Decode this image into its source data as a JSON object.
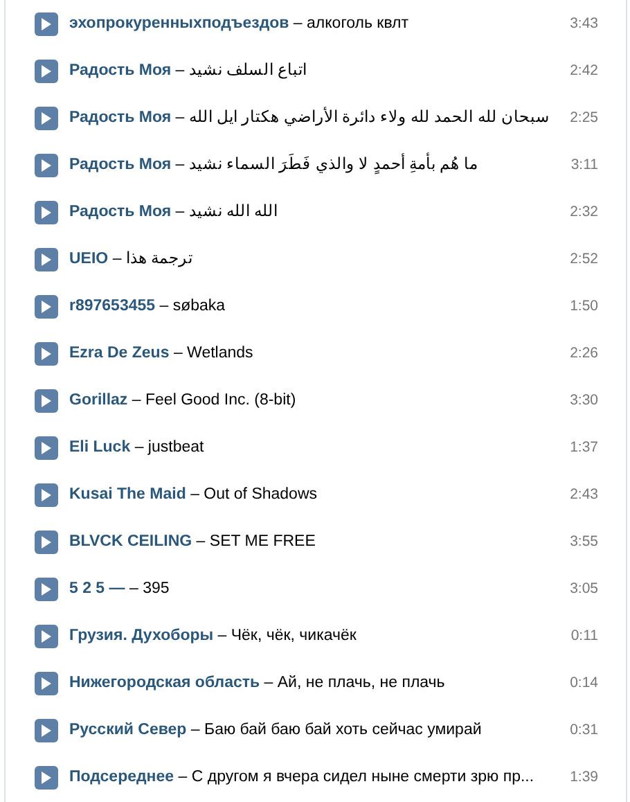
{
  "separator": "–",
  "tracks": [
    {
      "artist": "эхопрокуренныхподъездов",
      "title": "алкоголь квлт",
      "duration": "3:43"
    },
    {
      "artist": "Радость Моя",
      "title": "اتباع السلف نشيد",
      "duration": "2:42"
    },
    {
      "artist": "Радость Моя",
      "title": "سبحان لله الحمد لله ولاء دائرة الأراضي هكتار ايل الله",
      "duration": "2:25"
    },
    {
      "artist": "Радость Моя",
      "title": "ما هُم بأمةِ أحمدٍ لا والذي فَطَرَ السماء نشيد",
      "duration": "3:11"
    },
    {
      "artist": "Радость Моя",
      "title": "الله الله نشيد",
      "duration": "2:32"
    },
    {
      "artist": "UEIO",
      "title": "ترجمة هذا",
      "duration": "2:52"
    },
    {
      "artist": "r897653455",
      "title": "søbaka",
      "duration": "1:50"
    },
    {
      "artist": "Ezra De Zeus",
      "title": "Wetlands",
      "duration": "2:26"
    },
    {
      "artist": "Gorillaz",
      "title": "Feel Good Inc. (8-bit)",
      "duration": "3:30"
    },
    {
      "artist": "Eli Luck",
      "title": "justbeat",
      "duration": "1:37"
    },
    {
      "artist": "Kusai The Maid",
      "title": "Out of Shadows",
      "duration": "2:43"
    },
    {
      "artist": "BLVCK CEILING",
      "title": "SET ME FREE",
      "duration": "3:55"
    },
    {
      "artist": "5 2 5 —",
      "title": "395",
      "duration": "3:05"
    },
    {
      "artist": "Грузия. Духоборы",
      "title": "Чёк, чёк, чикачёк",
      "duration": "0:11"
    },
    {
      "artist": "Нижегородская область",
      "title": "Ай, не плачь, не плачь",
      "duration": "0:14"
    },
    {
      "artist": "Русский Север",
      "title": "Баю бай баю бай хоть сейчас умирай",
      "duration": "0:31"
    },
    {
      "artist": "Подсереднее",
      "title": "С другом я вчера сидел ныне смерти зрю пр...",
      "duration": "1:39"
    }
  ]
}
